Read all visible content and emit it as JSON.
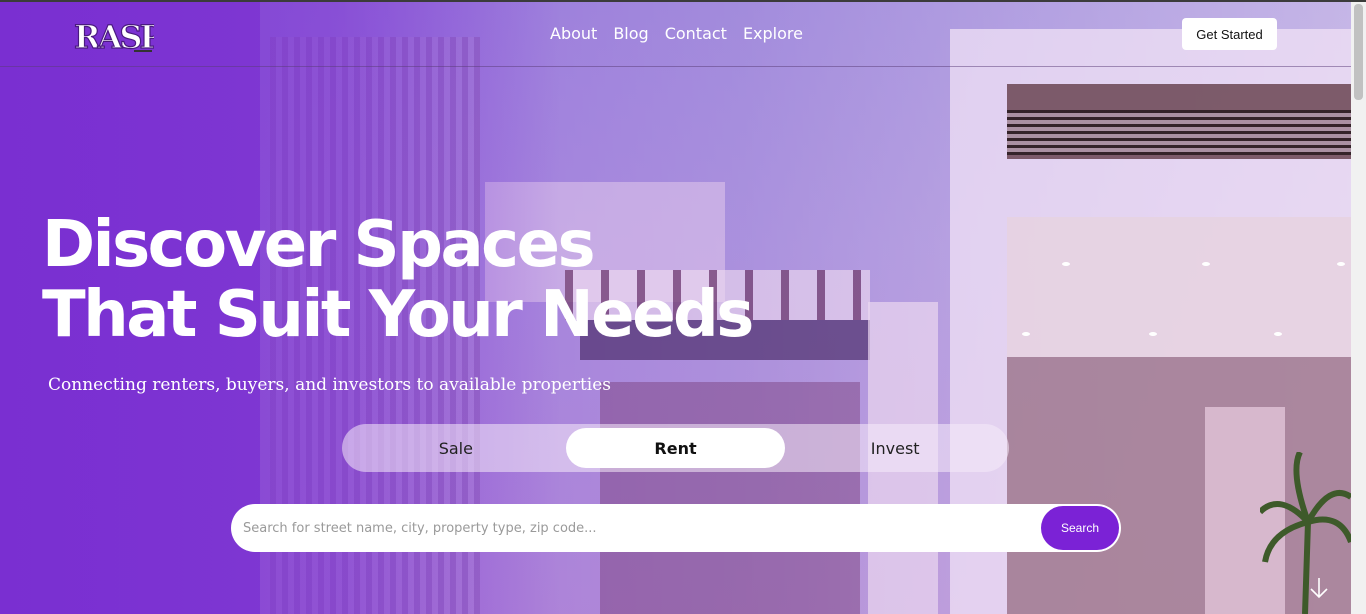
{
  "brand": {
    "logo_text": "RASP"
  },
  "nav": {
    "links": [
      "About",
      "Blog",
      "Contact",
      "Explore"
    ],
    "cta_label": "Get Started"
  },
  "hero": {
    "title_line1": "Discover Spaces",
    "title_line2": "That Suit Your Needs",
    "subtitle": "Connecting renters, buyers, and investors to available properties"
  },
  "tabs": {
    "items": [
      "Sale",
      "Rent",
      "Invest"
    ],
    "active": "Rent"
  },
  "search": {
    "placeholder": "Search for street name, city, property type, zip code...",
    "value": "",
    "button_label": "Search"
  },
  "icons": {
    "scroll_down": "arrow-down-icon"
  },
  "colors": {
    "accent": "#7b22d6",
    "hero_purple": "#7a2fd1"
  }
}
